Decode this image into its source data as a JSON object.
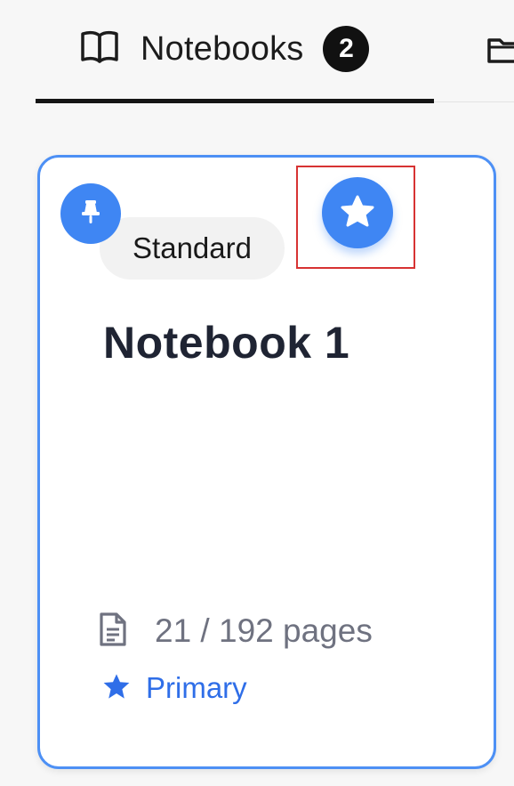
{
  "tabs": {
    "active": {
      "label": "Notebooks",
      "count": "2",
      "icon": "book-open-icon"
    },
    "next": {
      "icon": "folder-icon"
    }
  },
  "card": {
    "pin_icon": "pin-icon",
    "type_label": "Standard",
    "favorite_icon": "star-icon",
    "title": "Notebook 1",
    "pages_icon": "document-icon",
    "pages_text": "21 / 192 pages",
    "status_icon": "star-icon",
    "status_label": "Primary"
  },
  "colors": {
    "accent": "#3f86f3",
    "card_border": "#4d90f5",
    "highlight": "#d73333",
    "status_text": "#2f6ee8",
    "title_text": "#1f2433",
    "muted_text": "#6f7280"
  }
}
